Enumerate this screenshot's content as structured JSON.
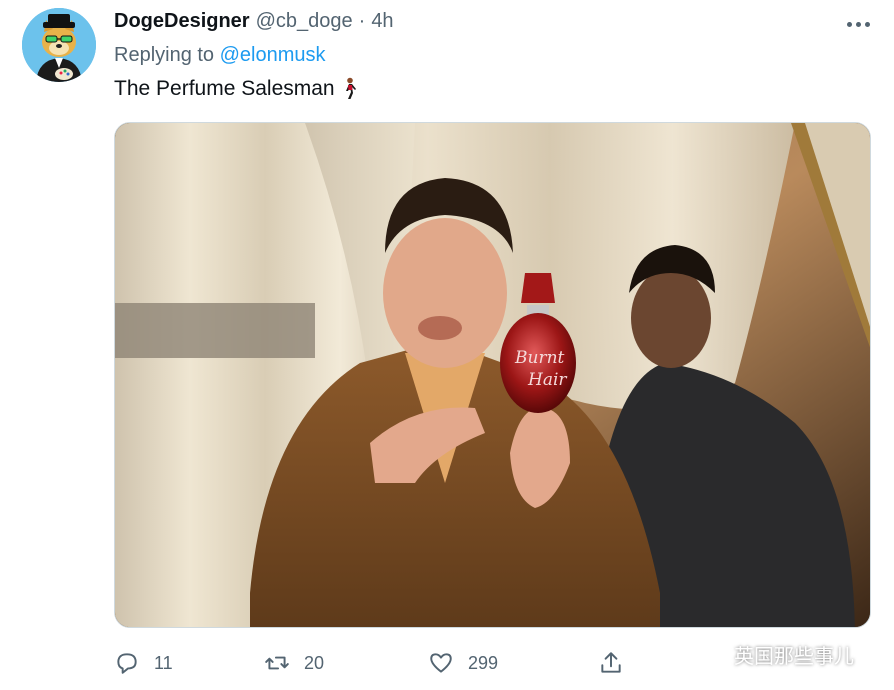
{
  "tweet": {
    "author_name": "DogeDesigner",
    "author_handle": "@cb_doge",
    "separator": "·",
    "time": "4h",
    "replying_prefix": "Replying to",
    "replying_to": "@elonmusk",
    "text": "The Perfume Salesman",
    "text_emoji": "person-walking-emoji",
    "bottle_label_line1": "Burnt",
    "bottle_label_line2": "Hair"
  },
  "actions": {
    "reply_count": "11",
    "retweet_count": "20",
    "like_count": "299",
    "reply_icon": "reply-icon",
    "retweet_icon": "retweet-icon",
    "like_icon": "heart-icon",
    "share_icon": "share-icon"
  },
  "watermark": {
    "text": "英国那些事儿",
    "icon": "wechat-icon"
  },
  "colors": {
    "link": "#1d9bf0",
    "secondary_text": "#536471",
    "primary_text": "#0f1419"
  }
}
